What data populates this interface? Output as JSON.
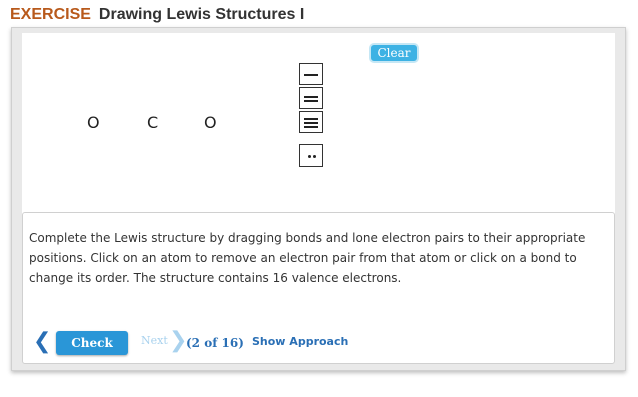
{
  "header": {
    "label": "EXERCISE",
    "title": "Drawing Lewis Structures I"
  },
  "canvas": {
    "clear_label": "Clear",
    "atoms": [
      "O",
      "C",
      "O"
    ],
    "palette": [
      "single-bond-icon",
      "double-bond-icon",
      "triple-bond-icon",
      "lone-pair-icon"
    ]
  },
  "instructions": {
    "text": "Complete the Lewis structure by dragging bonds and lone electron pairs to their appropriate positions. Click on an atom to remove an electron pair from that atom or click on a bond to change its order. The structure contains 16 valence electrons."
  },
  "nav": {
    "prev_arrow": "❮",
    "check_label": "Check",
    "next_label": "Next",
    "next_arrow": "❯",
    "page_count": "(2 of 16)",
    "show_approach": "Show Approach"
  },
  "colors": {
    "exercise_label": "#b8591b",
    "button_blue": "#2a96d7",
    "link_blue": "#2a6fb5"
  }
}
